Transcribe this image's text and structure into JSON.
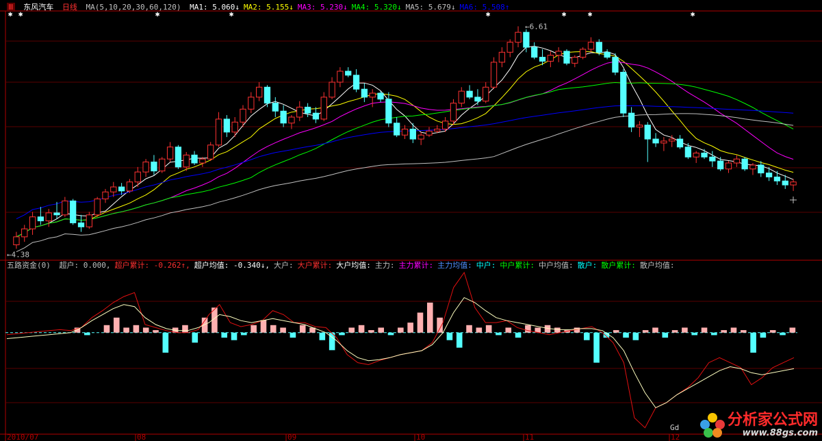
{
  "window": {
    "marker": "Ⅲ"
  },
  "header_main": {
    "stock": "东风汽车",
    "period": "日线",
    "ma_params": "MA(5,10,20,30,60,120)",
    "items": [
      {
        "label": "MA1: 5.060↓",
        "color": "#ffffff"
      },
      {
        "label": "MA2: 5.155↓",
        "color": "#ffff00"
      },
      {
        "label": "MA3: 5.230↓",
        "color": "#ff00ff"
      },
      {
        "label": "MA4: 5.320↓",
        "color": "#00ff00"
      },
      {
        "label": "MA5: 5.679↓",
        "color": "#c0c0c0"
      },
      {
        "label": "MA6: 5.508↑",
        "color": "#0000ff"
      }
    ]
  },
  "header_sub": {
    "name": "五路资金(0)",
    "items": [
      {
        "label": "超户: 0.000,",
        "color": "#c0c0c0"
      },
      {
        "label": "超户累计: -0.262↑,",
        "color": "#ff3030"
      },
      {
        "label": "超户均值: -0.340↓,",
        "color": "#ffffff"
      },
      {
        "label": "大户:",
        "color": "#c0c0c0"
      },
      {
        "label": "大户累计:",
        "color": "#ff3030"
      },
      {
        "label": "大户均值:",
        "color": "#ffffff"
      },
      {
        "label": "主力:",
        "color": "#c0c0c0"
      },
      {
        "label": "主力累计:",
        "color": "#ff00ff"
      },
      {
        "label": "主力均值:",
        "color": "#4f8fff"
      },
      {
        "label": "中户:",
        "color": "#00ffff"
      },
      {
        "label": "中户累计:",
        "color": "#00ff00"
      },
      {
        "label": "中户均值:",
        "color": "#c0c0c0"
      },
      {
        "label": "散户:",
        "color": "#00ffff"
      },
      {
        "label": "散户累计:",
        "color": "#00ff00"
      },
      {
        "label": "散户均值:",
        "color": "#c0c0c0"
      }
    ]
  },
  "annotations": {
    "high": "6.61",
    "low": "4.38",
    "gd_text": "Gd"
  },
  "dates": [
    "2010/07",
    "08",
    "09",
    "10",
    "11",
    "12"
  ],
  "watermark": {
    "title": "分析家公式网",
    "url": "www.88gs.com"
  },
  "chart_data": {
    "type": "candlestick",
    "main": {
      "candles_ohlc": [
        [
          4.42,
          4.55,
          4.38,
          4.5
        ],
        [
          4.5,
          4.62,
          4.45,
          4.58
        ],
        [
          4.58,
          4.75,
          4.52,
          4.7
        ],
        [
          4.7,
          4.8,
          4.62,
          4.66
        ],
        [
          4.66,
          4.78,
          4.6,
          4.74
        ],
        [
          4.74,
          4.85,
          4.68,
          4.72
        ],
        [
          4.72,
          4.9,
          4.7,
          4.86
        ],
        [
          4.86,
          4.88,
          4.62,
          4.64
        ],
        [
          4.64,
          4.72,
          4.55,
          4.6
        ],
        [
          4.6,
          4.75,
          4.58,
          4.72
        ],
        [
          4.72,
          4.9,
          4.7,
          4.88
        ],
        [
          4.88,
          4.98,
          4.84,
          4.95
        ],
        [
          4.95,
          5.05,
          4.9,
          5.0
        ],
        [
          5.0,
          5.04,
          4.92,
          4.96
        ],
        [
          4.96,
          5.08,
          4.94,
          5.05
        ],
        [
          5.05,
          5.2,
          5.0,
          5.15
        ],
        [
          5.15,
          5.28,
          5.1,
          5.25
        ],
        [
          5.25,
          5.32,
          5.12,
          5.16
        ],
        [
          5.16,
          5.3,
          5.14,
          5.28
        ],
        [
          5.28,
          5.45,
          5.25,
          5.4
        ],
        [
          5.4,
          5.42,
          5.18,
          5.2
        ],
        [
          5.2,
          5.35,
          5.16,
          5.32
        ],
        [
          5.32,
          5.36,
          5.22,
          5.24
        ],
        [
          5.24,
          5.3,
          5.2,
          5.28
        ],
        [
          5.28,
          5.45,
          5.26,
          5.42
        ],
        [
          5.42,
          5.75,
          5.4,
          5.68
        ],
        [
          5.68,
          5.72,
          5.5,
          5.55
        ],
        [
          5.55,
          5.7,
          5.5,
          5.65
        ],
        [
          5.65,
          5.82,
          5.6,
          5.78
        ],
        [
          5.78,
          5.95,
          5.74,
          5.9
        ],
        [
          5.9,
          6.05,
          5.86,
          6.0
        ],
        [
          6.0,
          6.02,
          5.8,
          5.84
        ],
        [
          5.84,
          5.9,
          5.7,
          5.76
        ],
        [
          5.76,
          5.82,
          5.6,
          5.64
        ],
        [
          5.64,
          5.72,
          5.58,
          5.7
        ],
        [
          5.7,
          5.86,
          5.66,
          5.8
        ],
        [
          5.8,
          5.84,
          5.7,
          5.74
        ],
        [
          5.74,
          5.8,
          5.64,
          5.68
        ],
        [
          5.68,
          5.95,
          5.66,
          5.9
        ],
        [
          5.9,
          6.1,
          5.88,
          6.05
        ],
        [
          6.05,
          6.2,
          6.0,
          6.16
        ],
        [
          6.16,
          6.2,
          6.1,
          6.12
        ],
        [
          6.12,
          6.18,
          5.95,
          5.98
        ],
        [
          5.98,
          6.04,
          5.85,
          5.9
        ],
        [
          5.9,
          5.98,
          5.8,
          5.94
        ],
        [
          5.94,
          5.96,
          5.85,
          5.88
        ],
        [
          5.88,
          5.95,
          5.6,
          5.64
        ],
        [
          5.64,
          5.7,
          5.5,
          5.52
        ],
        [
          5.52,
          5.62,
          5.48,
          5.58
        ],
        [
          5.58,
          5.64,
          5.44,
          5.48
        ],
        [
          5.48,
          5.55,
          5.42,
          5.52
        ],
        [
          5.52,
          5.6,
          5.5,
          5.56
        ],
        [
          5.56,
          5.62,
          5.54,
          5.58
        ],
        [
          5.58,
          5.7,
          5.55,
          5.66
        ],
        [
          5.66,
          5.88,
          5.62,
          5.84
        ],
        [
          5.84,
          6.0,
          5.8,
          5.96
        ],
        [
          5.96,
          6.02,
          5.88,
          5.9
        ],
        [
          5.9,
          5.98,
          5.82,
          5.86
        ],
        [
          5.86,
          6.05,
          5.84,
          6.0
        ],
        [
          6.0,
          6.3,
          5.98,
          6.25
        ],
        [
          6.25,
          6.4,
          6.2,
          6.35
        ],
        [
          6.35,
          6.48,
          6.3,
          6.45
        ],
        [
          6.45,
          6.61,
          6.4,
          6.55
        ],
        [
          6.55,
          6.58,
          6.35,
          6.4
        ],
        [
          6.4,
          6.45,
          6.28,
          6.3
        ],
        [
          6.3,
          6.38,
          6.22,
          6.26
        ],
        [
          6.26,
          6.36,
          6.2,
          6.32
        ],
        [
          6.32,
          6.4,
          6.25,
          6.36
        ],
        [
          6.36,
          6.38,
          6.22,
          6.24
        ],
        [
          6.24,
          6.32,
          6.2,
          6.3
        ],
        [
          6.3,
          6.4,
          6.28,
          6.38
        ],
        [
          6.38,
          6.5,
          6.35,
          6.45
        ],
        [
          6.45,
          6.48,
          6.32,
          6.35
        ],
        [
          6.35,
          6.38,
          6.28,
          6.3
        ],
        [
          6.3,
          6.34,
          6.12,
          6.15
        ],
        [
          6.15,
          6.18,
          5.7,
          5.74
        ],
        [
          5.74,
          5.8,
          5.55,
          5.6
        ],
        [
          5.6,
          5.66,
          5.5,
          5.62
        ],
        [
          5.62,
          5.65,
          5.25,
          5.48
        ],
        [
          5.48,
          5.54,
          5.4,
          5.44
        ],
        [
          5.44,
          5.5,
          5.36,
          5.46
        ],
        [
          5.46,
          5.52,
          5.4,
          5.48
        ],
        [
          5.48,
          5.52,
          5.38,
          5.4
        ],
        [
          5.4,
          5.44,
          5.28,
          5.3
        ],
        [
          5.3,
          5.36,
          5.24,
          5.34
        ],
        [
          5.34,
          5.38,
          5.28,
          5.3
        ],
        [
          5.3,
          5.36,
          5.2,
          5.26
        ],
        [
          5.26,
          5.3,
          5.16,
          5.18
        ],
        [
          5.18,
          5.26,
          5.14,
          5.24
        ],
        [
          5.24,
          5.32,
          5.2,
          5.28
        ],
        [
          5.28,
          5.3,
          5.16,
          5.18
        ],
        [
          5.18,
          5.24,
          5.12,
          5.22
        ],
        [
          5.22,
          5.26,
          5.1,
          5.14
        ],
        [
          5.14,
          5.2,
          5.06,
          5.1
        ],
        [
          5.1,
          5.16,
          5.02,
          5.06
        ],
        [
          5.06,
          5.12,
          4.98,
          5.02
        ],
        [
          5.02,
          5.08,
          4.96,
          5.05
        ]
      ],
      "ylim": [
        4.3,
        6.75
      ]
    },
    "sub": {
      "bars": [
        0,
        0,
        0,
        0,
        0,
        0,
        0.02,
        -0.01,
        0,
        0.03,
        0.06,
        0.02,
        0.03,
        0.02,
        0.01,
        -0.08,
        0.02,
        0.03,
        -0.04,
        0.06,
        0.1,
        -0.02,
        -0.03,
        -0.01,
        0.03,
        0.05,
        0.03,
        0.02,
        -0.02,
        0.03,
        0.02,
        -0.03,
        -0.07,
        -0.01,
        0.02,
        0.03,
        0.01,
        0.02,
        -0.01,
        0.02,
        0.04,
        0.08,
        0.12,
        0.06,
        -0.03,
        -0.06,
        0.03,
        0.02,
        0.03,
        -0.01,
        0.02,
        -0.02,
        0.03,
        0.02,
        0.03,
        0.02,
        0.01,
        0.02,
        -0.03,
        -0.12,
        -0.02,
        0.01,
        -0.02,
        -0.03,
        0.01,
        0.02,
        -0.02,
        0.01,
        0.02,
        -0.01,
        0.02,
        -0.01,
        0.01,
        0.02,
        0.01,
        -0.08,
        -0.02,
        0.01,
        -0.01,
        0.02
      ],
      "lines": {
        "red": [
          -0.02,
          -0.01,
          0.0,
          0.01,
          0.02,
          0.03,
          0.02,
          0.05,
          0.15,
          0.22,
          0.3,
          0.36,
          0.4,
          0.08,
          0.05,
          0.02,
          0.0,
          0.0,
          0.03,
          0.18,
          0.28,
          0.1,
          0.06,
          0.08,
          0.12,
          0.22,
          0.18,
          0.1,
          0.1,
          0.06,
          0.05,
          -0.05,
          -0.22,
          -0.3,
          -0.32,
          -0.28,
          -0.25,
          -0.22,
          -0.2,
          -0.18,
          -0.1,
          0.1,
          0.45,
          0.6,
          0.25,
          0.1,
          0.1,
          0.12,
          0.05,
          0.02,
          0.0,
          -0.02,
          0.0,
          0.02,
          0.04,
          0.06,
          0.0,
          -0.1,
          -0.3,
          -0.85,
          -0.95,
          -0.75,
          -0.7,
          -0.62,
          -0.55,
          -0.45,
          -0.3,
          -0.25,
          -0.3,
          -0.35,
          -0.52,
          -0.45,
          -0.35,
          -0.3,
          -0.25
        ],
        "white": [
          -0.06,
          -0.05,
          -0.04,
          -0.03,
          -0.02,
          -0.01,
          0.0,
          0.05,
          0.12,
          0.18,
          0.24,
          0.28,
          0.26,
          0.15,
          0.08,
          0.04,
          0.02,
          0.02,
          0.05,
          0.1,
          0.18,
          0.16,
          0.12,
          0.1,
          0.12,
          0.14,
          0.12,
          0.1,
          0.08,
          0.04,
          0.0,
          -0.08,
          -0.18,
          -0.25,
          -0.28,
          -0.27,
          -0.25,
          -0.22,
          -0.2,
          -0.18,
          -0.12,
          0.0,
          0.2,
          0.35,
          0.3,
          0.22,
          0.15,
          0.12,
          0.1,
          0.08,
          0.06,
          0.04,
          0.03,
          0.03,
          0.04,
          0.04,
          0.02,
          -0.05,
          -0.18,
          -0.4,
          -0.6,
          -0.75,
          -0.7,
          -0.62,
          -0.56,
          -0.5,
          -0.44,
          -0.38,
          -0.34,
          -0.36,
          -0.4,
          -0.42,
          -0.4,
          -0.38,
          -0.36
        ]
      },
      "ylim": [
        -1.0,
        0.6
      ]
    }
  }
}
